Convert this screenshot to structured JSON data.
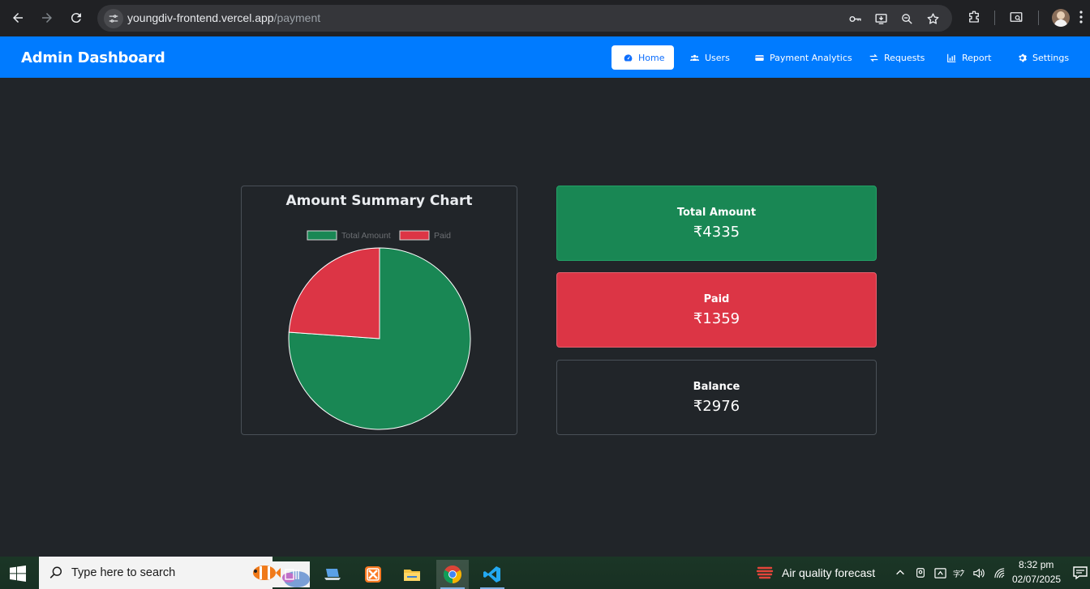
{
  "browser": {
    "url_host": "youngdiv-frontend.vercel.app",
    "url_path": "/payment"
  },
  "navbar": {
    "brand": "Admin Dashboard",
    "items": [
      {
        "label": "Home",
        "icon": "dashboard-icon",
        "active": true
      },
      {
        "label": "Users",
        "icon": "users-icon",
        "active": false
      },
      {
        "label": "Payment Analytics",
        "icon": "credit-card-icon",
        "active": false
      },
      {
        "label": "Requests",
        "icon": "exchange-icon",
        "active": false
      },
      {
        "label": "Report",
        "icon": "bar-chart-icon",
        "active": false
      },
      {
        "label": "Settings",
        "icon": "gear-icon",
        "active": false
      }
    ]
  },
  "chart_data": {
    "type": "pie",
    "title": "Amount Summary Chart",
    "categories": [
      "Total Amount",
      "Paid"
    ],
    "values": [
      4335,
      1359
    ],
    "colors": [
      "#198754",
      "#dc3545"
    ],
    "legend": "top"
  },
  "summary": {
    "total": {
      "label": "Total Amount",
      "value": "₹4335"
    },
    "paid": {
      "label": "Paid",
      "value": "₹1359"
    },
    "balance": {
      "label": "Balance",
      "value": "₹2976"
    }
  },
  "taskbar": {
    "search_placeholder": "Type here to search",
    "weather": "Air quality forecast",
    "time": "8:32 pm",
    "date": "02/07/2025"
  }
}
